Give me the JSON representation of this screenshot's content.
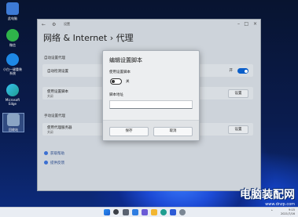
{
  "desktop": {
    "icons": [
      {
        "label": "此电脑",
        "icon": "computer-icon",
        "color": "#3d7ad6"
      },
      {
        "label": "微信",
        "icon": "wechat-icon",
        "color": "#2fb34a"
      },
      {
        "label": "小白一键重装\n系统",
        "icon": "reinstall-icon",
        "color": "#1e88e5"
      },
      {
        "label": "Microsoft\nEdge",
        "icon": "edge-icon",
        "color": "#1f9d8f"
      },
      {
        "label": "回收站",
        "icon": "recycle-bin-icon",
        "color": "#8aa4c4"
      }
    ]
  },
  "settings": {
    "app_title": "设置",
    "back_glyph": "←",
    "heading": "网络 & Internet  ›  代理",
    "auto_section": "自动设置代理",
    "auto_detect": {
      "title": "自动检测设置",
      "state": "开"
    },
    "use_script": {
      "title": "使用设置脚本",
      "state": "关闭",
      "button": "设置"
    },
    "manual_section": "手动设置代理",
    "use_proxy": {
      "title": "使用代理服务器",
      "state": "关闭",
      "button": "设置"
    },
    "help_link": "获取帮助",
    "feedback_link": "提供反馈"
  },
  "dialog": {
    "title": "编辑设置脚本",
    "script_label": "使用设置脚本",
    "toggle_state": "关",
    "address_label": "脚本地址",
    "address_value": "",
    "save": "保存",
    "cancel": "取消"
  },
  "taskbar": {
    "icons": [
      "start-icon",
      "search-icon",
      "taskview-icon",
      "widgets-icon",
      "chat-icon",
      "explorer-icon",
      "edge-icon",
      "store-icon",
      "settings-icon"
    ],
    "time": "9:15",
    "date": "2021/7/16"
  },
  "watermark": {
    "line1": "电脑装配网",
    "line2": "www.dnzp.com"
  }
}
